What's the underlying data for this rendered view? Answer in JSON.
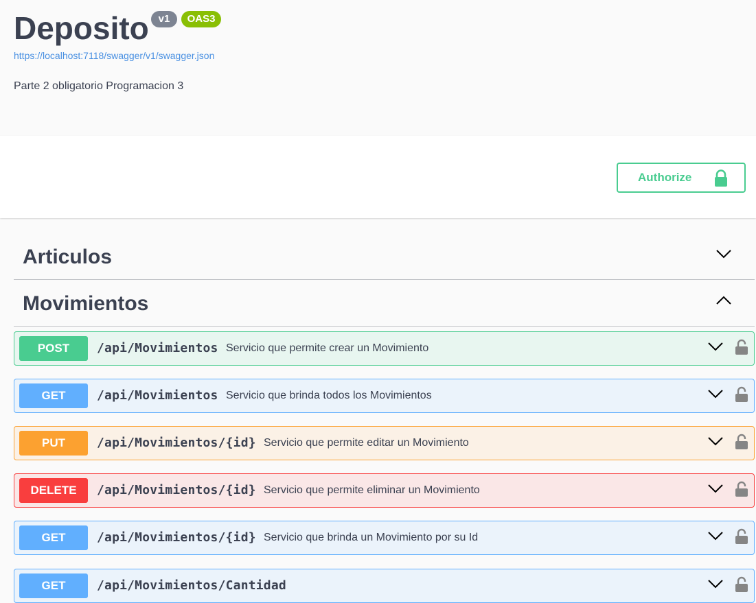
{
  "info": {
    "title": "Deposito",
    "version_badge": "v1",
    "oas_badge": "OAS3",
    "spec_url": "https://localhost:7118/swagger/v1/swagger.json",
    "description": "Parte 2 obligatorio Programacion 3"
  },
  "auth": {
    "button_label": "Authorize",
    "icon": "lock-icon",
    "color": "#49cc90"
  },
  "tags": [
    {
      "name": "Articulos",
      "expanded": false
    },
    {
      "name": "Movimientos",
      "expanded": true
    }
  ],
  "operations": [
    {
      "method": "POST",
      "path": "/api/Movimientos",
      "summary": "Servicio que permite crear un Movimiento",
      "color": "#49cc90",
      "bg": "#e8f6f0"
    },
    {
      "method": "GET",
      "path": "/api/Movimientos",
      "summary": "Servicio que brinda todos los Movimientos",
      "color": "#61affe",
      "bg": "#ebf3fb"
    },
    {
      "method": "PUT",
      "path": "/api/Movimientos/{id}",
      "summary": "Servicio que permite editar un Movimiento",
      "color": "#fca130",
      "bg": "#fbf1e6"
    },
    {
      "method": "DELETE",
      "path": "/api/Movimientos/{id}",
      "summary": "Servicio que permite eliminar un Movimiento",
      "color": "#f93e3e",
      "bg": "#fae7e7"
    },
    {
      "method": "GET",
      "path": "/api/Movimientos/{id}",
      "summary": "Servicio que brinda un Movimiento por su Id",
      "color": "#61affe",
      "bg": "#ebf3fb"
    },
    {
      "method": "GET",
      "path": "/api/Movimientos/Cantidad",
      "summary": "",
      "color": "#61affe",
      "bg": "#ebf3fb"
    }
  ]
}
